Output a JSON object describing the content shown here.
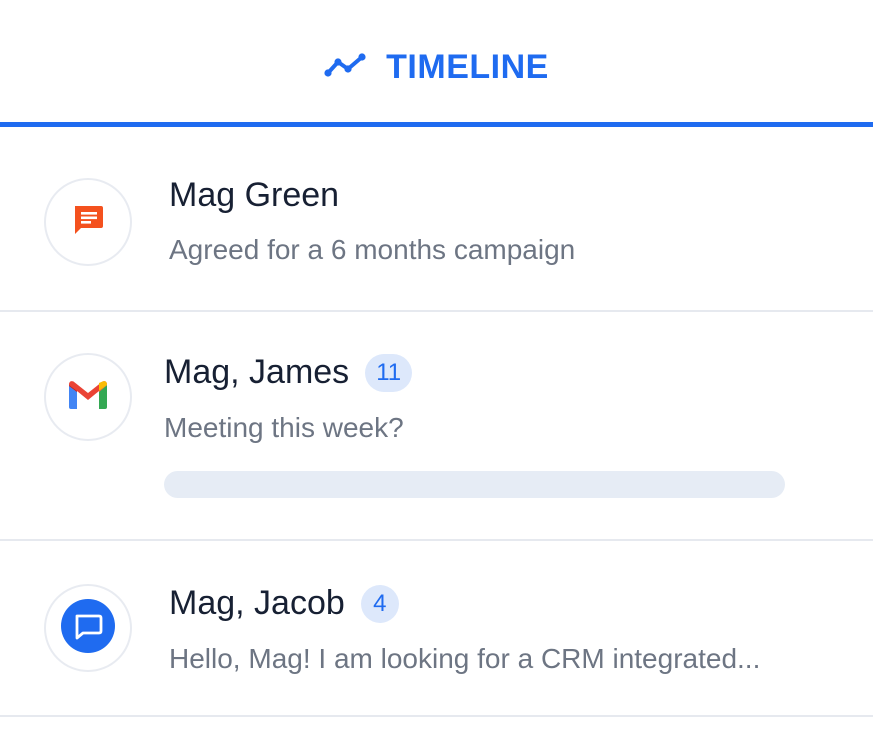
{
  "tab": {
    "label": "TIMELINE",
    "icon": "trend-line-icon",
    "color": "#1f6bf0"
  },
  "items": [
    {
      "name": "Mag Green",
      "preview": "Agreed for a 6 months campaign",
      "icon": "chat-note-icon",
      "icon_color": "#f4511e"
    },
    {
      "name": "Mag, James",
      "badge": "11",
      "preview": "Meeting this week?",
      "icon": "gmail-icon",
      "progress": 0
    },
    {
      "name": "Mag, Jacob",
      "badge": "4",
      "preview": "Hello, Mag! I am looking for a CRM integrated...",
      "icon": "message-bubble-icon",
      "icon_color": "#1f6bf0"
    }
  ]
}
